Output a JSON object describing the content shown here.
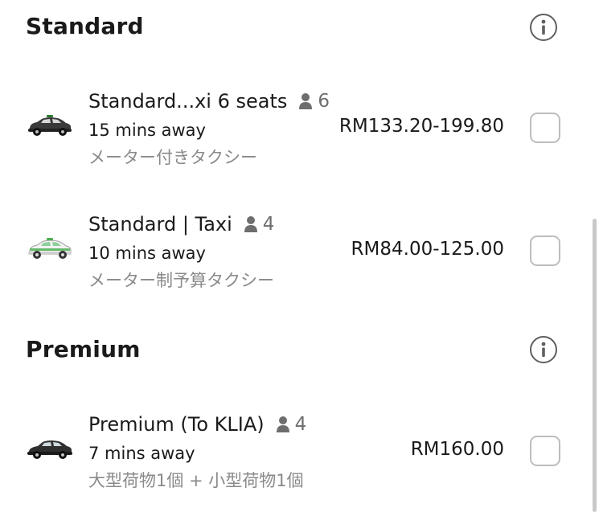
{
  "sections": [
    {
      "title": "Standard",
      "info_icon": "info-icon",
      "options": [
        {
          "name": "Standard...xi 6 seats",
          "seats": "6",
          "eta": "15 mins away",
          "description": "メーター付きタクシー",
          "price": "RM133.20-199.80",
          "icon": "dark-taxi-car-icon",
          "checked": false
        },
        {
          "name": "Standard | Taxi",
          "seats": "4",
          "eta": "10 mins away",
          "description": "メーター制予算タクシー",
          "price": "RM84.00-125.00",
          "icon": "light-taxi-car-icon",
          "checked": false
        }
      ]
    },
    {
      "title": "Premium",
      "info_icon": "info-icon",
      "options": [
        {
          "name": "Premium (To KLIA)",
          "seats": "4",
          "eta": "7 mins away",
          "description": "大型荷物1個 + 小型荷物1個",
          "price": "RM160.00",
          "icon": "premium-car-icon",
          "checked": false
        }
      ]
    }
  ],
  "colors": {
    "text_primary": "#1a1a1a",
    "text_secondary": "#8a8a8a",
    "seat_icon": "#6e6e6e",
    "checkbox_border": "#bdbdbd",
    "scrollbar": "#c8c8c8"
  }
}
